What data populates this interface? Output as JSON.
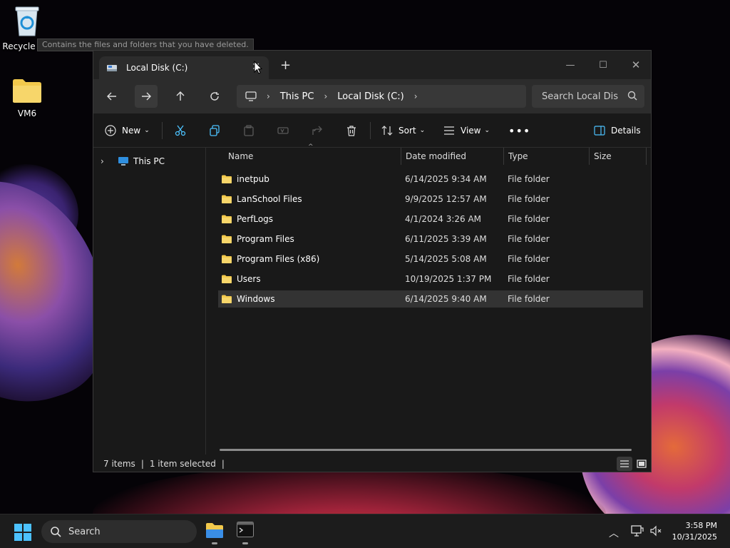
{
  "desktop": {
    "icons": [
      {
        "label": "Recycle Bin"
      },
      {
        "label": "VM6"
      }
    ],
    "tooltip": "Contains the files and folders that you have deleted."
  },
  "window": {
    "tab_title": "Local Disk (C:)",
    "address": {
      "segments": [
        "This PC",
        "Local Disk (C:)"
      ]
    },
    "search_placeholder": "Search Local Dis",
    "toolbar": {
      "new_label": "New",
      "sort_label": "Sort",
      "view_label": "View",
      "details_label": "Details"
    },
    "navpane": {
      "this_pc_label": "This PC"
    },
    "columns": {
      "name": "Name",
      "date": "Date modified",
      "type": "Type",
      "size": "Size"
    },
    "files": [
      {
        "name": "inetpub",
        "date": "6/14/2025 9:34 AM",
        "type": "File folder"
      },
      {
        "name": "LanSchool Files",
        "date": "9/9/2025 12:57 AM",
        "type": "File folder"
      },
      {
        "name": "PerfLogs",
        "date": "4/1/2024 3:26 AM",
        "type": "File folder"
      },
      {
        "name": "Program Files",
        "date": "6/11/2025 3:39 AM",
        "type": "File folder"
      },
      {
        "name": "Program Files (x86)",
        "date": "5/14/2025 5:08 AM",
        "type": "File folder"
      },
      {
        "name": "Users",
        "date": "10/19/2025 1:37 PM",
        "type": "File folder"
      },
      {
        "name": "Windows",
        "date": "6/14/2025 9:40 AM",
        "type": "File folder"
      }
    ],
    "selected_index": 6,
    "status": {
      "item_count": "7 items",
      "selection": "1 item selected"
    }
  },
  "taskbar": {
    "search_label": "Search",
    "time": "3:58 PM",
    "date": "10/31/2025"
  },
  "colors": {
    "folder": "#f2c94c",
    "accent": "#4cc2ff",
    "window_bg": "#191919",
    "selected_row": "#333333"
  }
}
